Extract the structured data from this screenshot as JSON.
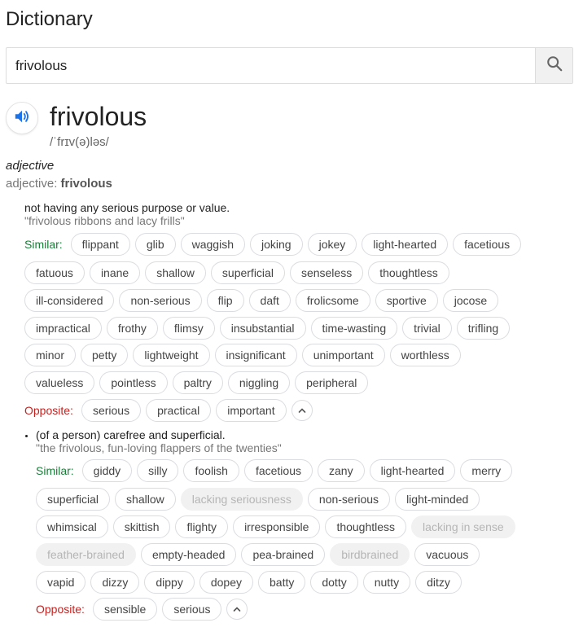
{
  "title": "Dictionary",
  "search": {
    "value": "frivolous"
  },
  "entry": {
    "word": "frivolous",
    "phonetic": "/ˈfrɪv(ə)ləs/",
    "part_of_speech": "adjective",
    "pos_label": "adjective:",
    "pos_word": "frivolous"
  },
  "labels": {
    "similar": "Similar:",
    "opposite": "Opposite:"
  },
  "senses": [
    {
      "definition": "not having any serious purpose or value.",
      "example": "\"frivolous ribbons and lacy frills\"",
      "similar_rows": [
        [
          "flippant",
          "glib",
          "waggish",
          "joking",
          "jokey",
          "light-hearted",
          "facetious"
        ],
        [
          "fatuous",
          "inane",
          "shallow",
          "superficial",
          "senseless",
          "thoughtless"
        ],
        [
          "ill-considered",
          "non-serious",
          "flip",
          "daft",
          "frolicsome",
          "sportive",
          "jocose"
        ],
        [
          "impractical",
          "frothy",
          "flimsy",
          "insubstantial",
          "time-wasting",
          "trivial",
          "trifling"
        ],
        [
          "minor",
          "petty",
          "lightweight",
          "insignificant",
          "unimportant",
          "worthless"
        ],
        [
          "valueless",
          "pointless",
          "paltry",
          "niggling",
          "peripheral"
        ]
      ],
      "opposite": [
        "serious",
        "practical",
        "important"
      ]
    },
    {
      "definition": "(of a person) carefree and superficial.",
      "example": "\"the frivolous, fun-loving flappers of the twenties\"",
      "similar_rows": [
        [
          "giddy",
          "silly",
          "foolish",
          "facetious",
          "zany",
          "light-hearted",
          "merry"
        ],
        [
          "superficial",
          "shallow",
          "lacking seriousness",
          "non-serious",
          "light-minded"
        ],
        [
          "whimsical",
          "skittish",
          "flighty",
          "irresponsible",
          "thoughtless",
          "lacking in sense"
        ],
        [
          "feather-brained",
          "empty-headed",
          "pea-brained",
          "birdbrained",
          "vacuous"
        ],
        [
          "vapid",
          "dizzy",
          "dippy",
          "dopey",
          "batty",
          "dotty",
          "nutty",
          "ditzy"
        ]
      ],
      "dimmed": [
        "lacking seriousness",
        "lacking in sense",
        "feather-brained",
        "birdbrained"
      ],
      "opposite": [
        "sensible",
        "serious"
      ]
    }
  ],
  "colors": {
    "similar": "#188038",
    "opposite": "#c5221f",
    "icon_blue": "#1a73e8"
  },
  "icons": {
    "search": "search-icon",
    "speaker": "speaker-icon",
    "collapse": "chevron-up-icon"
  }
}
